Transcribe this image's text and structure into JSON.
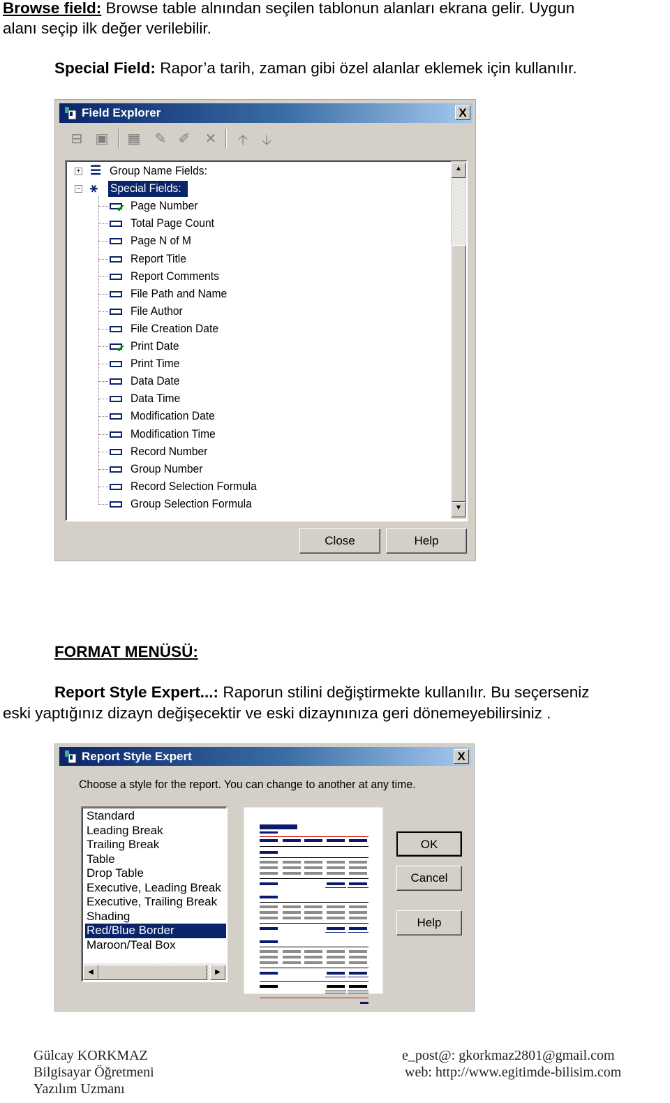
{
  "intro": {
    "browse_label": "Browse field:",
    "browse_text_1": " Browse table alnından seçilen tablonun alanları ekrana gelir.  Uygun",
    "browse_text_2": "alanı seçip ilk değer verilebilir.",
    "special_label": "Special Field:",
    "special_text": " Rapor’a tarih, zaman gibi özel alanlar eklemek için kullanılır."
  },
  "field_explorer": {
    "title": "Field Explorer",
    "close_x": "X",
    "toolbar": [
      "insert-field-icon",
      "browse-data-icon",
      "new-icon",
      "edit-icon",
      "rename-icon",
      "delete-icon",
      "move-up-icon",
      "move-down-icon"
    ],
    "group_name_fields": "Group Name Fields:",
    "special_fields": "Special Fields:",
    "items": [
      {
        "label": "Page Number",
        "checked": true
      },
      {
        "label": "Total Page Count",
        "checked": false
      },
      {
        "label": "Page N of M",
        "checked": false
      },
      {
        "label": "Report Title",
        "checked": false
      },
      {
        "label": "Report Comments",
        "checked": false
      },
      {
        "label": "File Path and Name",
        "checked": false
      },
      {
        "label": "File Author",
        "checked": false
      },
      {
        "label": "File Creation Date",
        "checked": false
      },
      {
        "label": "Print Date",
        "checked": true
      },
      {
        "label": "Print Time",
        "checked": false
      },
      {
        "label": "Data Date",
        "checked": false
      },
      {
        "label": "Data Time",
        "checked": false
      },
      {
        "label": "Modification Date",
        "checked": false
      },
      {
        "label": "Modification Time",
        "checked": false
      },
      {
        "label": "Record Number",
        "checked": false
      },
      {
        "label": "Group Number",
        "checked": false
      },
      {
        "label": "Record Selection Formula",
        "checked": false
      },
      {
        "label": "Group Selection Formula",
        "checked": false
      }
    ],
    "close_button": "Close",
    "help_button": "Help"
  },
  "format": {
    "heading": "FORMAT MENÜSÜ:",
    "rse_label": "Report Style Expert...:",
    "rse_text_1": "  Raporun stilini değiştirmekte kullanılır. Bu seçerseniz",
    "rse_text_2": "eski yaptığınız dizayn değişecektir ve eski dizaynınıza geri dönemeyebilirsiniz ."
  },
  "report_style_expert": {
    "title": "Report Style Expert",
    "close_x": "X",
    "instruction": "Choose a style for the report.  You can change to another at any time.",
    "styles": [
      "Standard",
      "Leading Break",
      "Trailing Break",
      "Table",
      "Drop Table",
      "Executive, Leading Break",
      "Executive, Trailing Break",
      "Shading",
      "Red/Blue Border",
      "Maroon/Teal Box"
    ],
    "selected": "Red/Blue Border",
    "ok_button": "OK",
    "cancel_button": "Cancel",
    "help_button": "Help",
    "colors": {
      "blue": "#0a1a6e",
      "red": "#cc0000",
      "gray": "#8c8c8c"
    }
  },
  "footer": {
    "name": "Gülcay KORKMAZ",
    "role1": "Bilgisayar Öğretmeni",
    "role2": "Yazılım Uzmanı",
    "email": "e_post@: gkorkmaz2801@gmail.com",
    "web": "web:  http://www.egitimde-bilisim.com"
  }
}
